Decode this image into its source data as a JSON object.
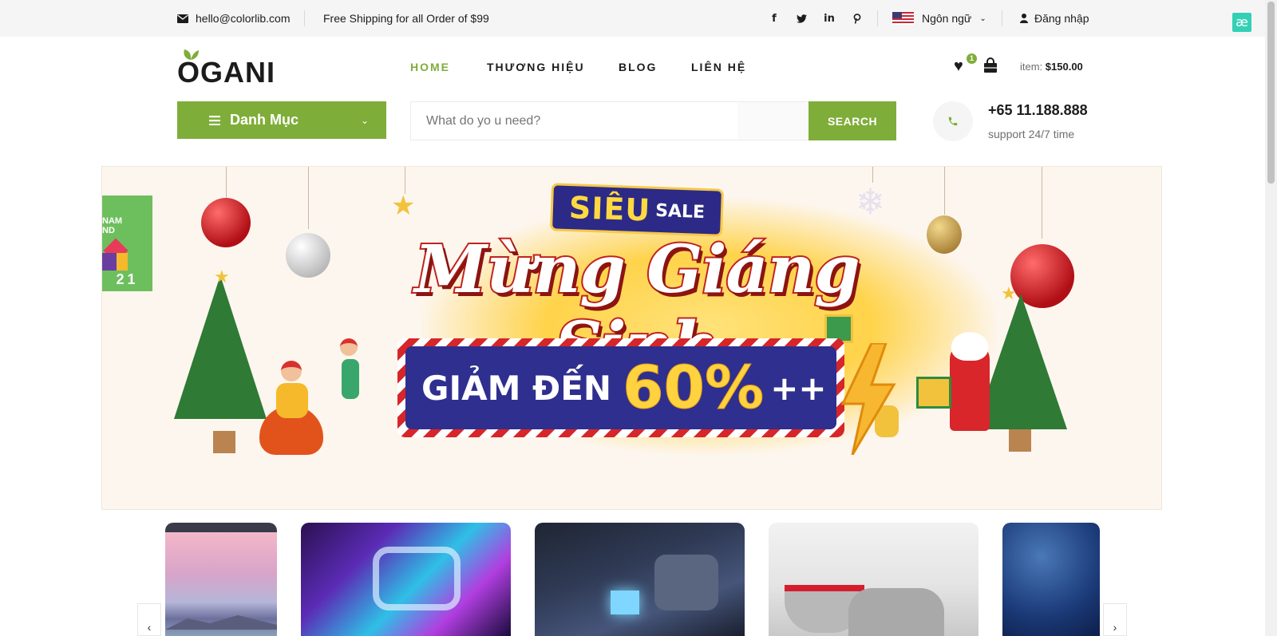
{
  "topbar": {
    "email": "hello@colorlib.com",
    "shipping": "Free Shipping for all Order of $99",
    "language": "Ngôn ngữ",
    "login": "Đăng nhập",
    "social_icons": [
      "facebook-icon",
      "twitter-icon",
      "linkedin-icon",
      "pinterest-icon"
    ],
    "extension_badge": "æ"
  },
  "header": {
    "logo": "OGANI",
    "nav": [
      "HOME",
      "THƯƠNG HIỆU",
      "BLOG",
      "LIÊN HỆ"
    ],
    "active_nav": "HOME",
    "wishlist_count": "1",
    "cart_label": "item:",
    "cart_total": "$150.00"
  },
  "hero_bar": {
    "departments_label": "Danh Mục",
    "search_placeholder": "What do yo u need?",
    "search_button": "SEARCH",
    "phone": "+65 11.188.888",
    "support": "support 24/7 time"
  },
  "banner": {
    "badge_main": "SIÊU",
    "badge_sale": "SALE",
    "headline": "Mừng Giáng Sinh",
    "discount_text": "GIẢM ĐẾN",
    "discount_value": "60%",
    "discount_suffix": "++",
    "side_card_text": "NAM ND",
    "side_card_year": "21"
  },
  "categories": {
    "prev_arrow": "‹",
    "next_arrow": "›"
  },
  "colors": {
    "accent": "#7fad39",
    "topbar_bg": "#f5f5f5",
    "text": "#1c1c1c",
    "banner_red": "#c0231f",
    "banner_blue": "#2e2f8f",
    "banner_gold": "#ffd23f"
  }
}
